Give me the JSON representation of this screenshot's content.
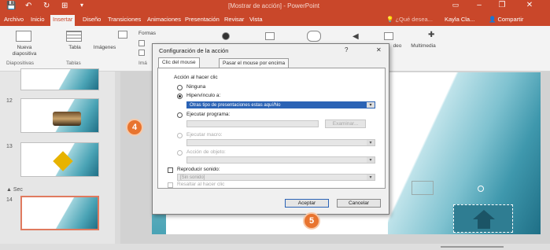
{
  "window": {
    "title": "[Mostrar de acción] - PowerPoint",
    "user": "Kayla Cla...",
    "share": "Compartir",
    "search_hint": "¿Qué desea...",
    "minimize": "–",
    "restore": "❐",
    "close": "✕"
  },
  "quick_access": [
    "💾",
    "↶",
    "↻",
    "⊞",
    "▾"
  ],
  "tabs": [
    {
      "label": "Archivo",
      "active": false
    },
    {
      "label": "Inicio",
      "active": false
    },
    {
      "label": "Insertar",
      "active": true
    },
    {
      "label": "Diseño",
      "active": false
    },
    {
      "label": "Transiciones",
      "active": false
    },
    {
      "label": "Animaciones",
      "active": false
    },
    {
      "label": "Presentación",
      "active": false
    },
    {
      "label": "Revisar",
      "active": false
    },
    {
      "label": "Vista",
      "active": false
    }
  ],
  "ribbon": {
    "new_slide": "Nueva diapositiva",
    "table": "Tabla",
    "images": "Imágenes",
    "shapes": "Formas",
    "group_slides": "Diapositivas",
    "group_tables": "Tablas",
    "group_images": "Imá",
    "video": "deo",
    "multimedia": "Multimedia"
  },
  "thumbnails": [
    {
      "number": "",
      "selected": false
    },
    {
      "number": "12",
      "selected": false
    },
    {
      "number": "13",
      "selected": false
    },
    {
      "number": "14",
      "selected": true
    }
  ],
  "section_label": "▲ Sec",
  "dialog": {
    "title": "Configuración de la acción",
    "help": "?",
    "close": "✕",
    "tab_mouse_click": "Clic del mouse",
    "tab_mouse_over": "Pasar el mouse por encima",
    "action_group": "Acción al hacer clic",
    "opt_none": "Ninguna",
    "opt_hyperlink": "Hipervínculo a:",
    "hyperlink_value": "Otras tipo de presentaciones estas aquí/No",
    "opt_run_program": "Ejecutar programa:",
    "browse": "Examinar...",
    "opt_run_macro": "Ejecutar macro:",
    "opt_object_action": "Acción de objeto:",
    "play_sound": "Reproducir sonido:",
    "sound_value": "[Sin sonido]",
    "highlight_click": "Resaltar al hacer clic",
    "accept": "Aceptar",
    "cancel": "Cancelar"
  },
  "callouts": {
    "step4": "4",
    "step5": "5"
  },
  "colors": {
    "accent": "#c9472a",
    "callout": "#e8742f",
    "teal": "#4aa3b5",
    "selection": "#2b63b5"
  }
}
